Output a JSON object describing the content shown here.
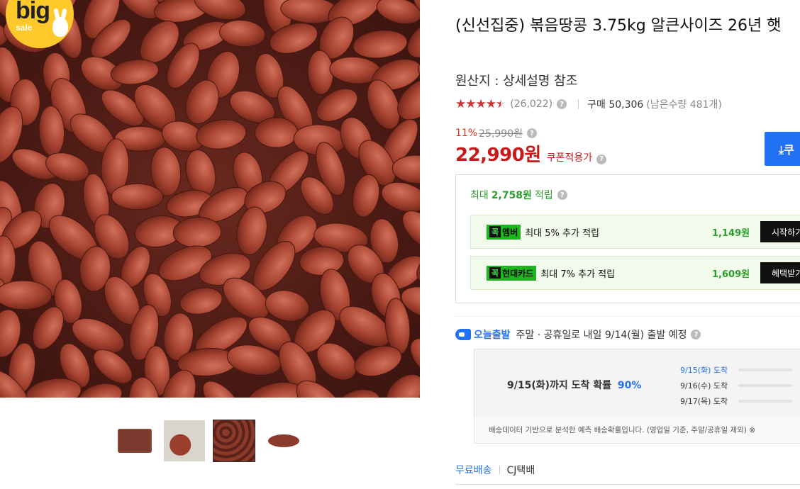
{
  "badge": {
    "big": "big",
    "sale": "sale"
  },
  "product": {
    "title": "(신선집중) 볶음땅콩 3.75kg 알큰사이즈 26년 햇",
    "origin": "원산지 : 상세설명 참조",
    "rating": 4.5,
    "rating_stars": "★★★★★",
    "review_count": "(26,022)",
    "purchase_count": "구매 50,306",
    "remaining": "(남은수량 481개)"
  },
  "pricing": {
    "discount_rate": "11%",
    "original_price": "25,990원",
    "price": "22,990원",
    "coupon_note": "쿠폰적용가",
    "coupon_button": "⤓쿠"
  },
  "rewards": {
    "max_prefix": "최대",
    "max_amount": "2,758원",
    "max_suffix": "적립",
    "cards": [
      {
        "tag_k": "꼭",
        "tag": "멤버",
        "text": "최대 5% 추가 적립",
        "amount": "1,149원",
        "button": "시작하기"
      },
      {
        "tag_k": "꼭",
        "tag": "현대카드",
        "text": "최대 7% 추가 적립",
        "amount": "1,609원",
        "button": "혜택받기"
      }
    ]
  },
  "shipping": {
    "name": "오늘출발",
    "desc": "주말 · 공휴일로 내일 9/14(월) 출발 예정",
    "probability_label": "9/15(화)까지 도착 확률",
    "probability": "90%",
    "arrivals": [
      {
        "label": "9/15(화) 도착",
        "fraction": 0.9
      },
      {
        "label": "9/16(수) 도착",
        "fraction": 0.0
      },
      {
        "label": "9/17(목) 도착",
        "fraction": 0.0
      }
    ],
    "note": "배송데이터 기반으로 분석한 예측 배송확률입니다. (영업일 기준, 주말/공휴일 제외) ⊗",
    "free": "무료배송",
    "courier": "CJ택배"
  },
  "colors": {
    "accent_blue": "#2171f3",
    "price_red": "#c81a1a",
    "reward_green": "#2c9e2c",
    "star_red": "#cc3333"
  },
  "icons": {
    "help": "?",
    "rocket": "rocket-icon"
  }
}
